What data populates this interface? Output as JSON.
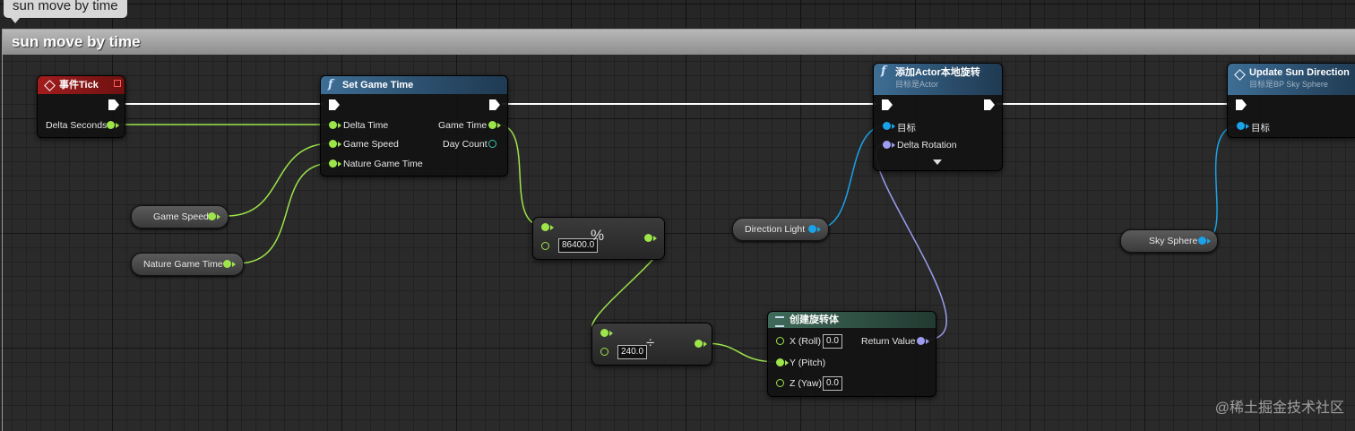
{
  "comment": {
    "tab_title": "sun move by time",
    "header_title": "sun move by time"
  },
  "nodes": {
    "event_tick": {
      "title": "事件Tick",
      "delta_seconds": "Delta Seconds"
    },
    "set_game_time": {
      "title": "Set Game Time",
      "delta_time": "Delta Time",
      "game_speed": "Game Speed",
      "nature_game_time": "Nature Game Time",
      "game_time": "Game Time",
      "day_count": "Day Count"
    },
    "modulo": {
      "symbol": "%",
      "value": "86400.0"
    },
    "divide": {
      "symbol": "÷",
      "value": "240.0"
    },
    "add_local_rotation": {
      "title": "添加Actor本地旋转",
      "subtitle": "目标是Actor",
      "target": "目标",
      "delta_rotation": "Delta Rotation"
    },
    "make_rotator": {
      "title": "创建旋转体",
      "x_label": "X (Roll)",
      "x_value": "0.0",
      "y_label": "Y (Pitch)",
      "z_label": "Z (Yaw)",
      "z_value": "0.0",
      "return_value": "Return Value"
    },
    "update_sun": {
      "title": "Update Sun Direction",
      "subtitle": "目标是BP Sky Sphere",
      "target": "目标"
    }
  },
  "variables": {
    "game_speed": "Game Speed",
    "nature_game_time": "Nature Game Time",
    "direction_light": "Direction Light",
    "sky_sphere": "Sky Sphere"
  },
  "watermark": "@稀土掘金技术社区",
  "colors": {
    "exec": "#ffffff",
    "float": "#9de54a",
    "object": "#1aa3e8",
    "rotator": "#9c9cf0",
    "function_header": "#3e6e95",
    "event_header": "#a21d1d"
  },
  "icons": {
    "function": "function-icon",
    "event": "event-diamond-icon",
    "make_struct": "struct-icon"
  }
}
